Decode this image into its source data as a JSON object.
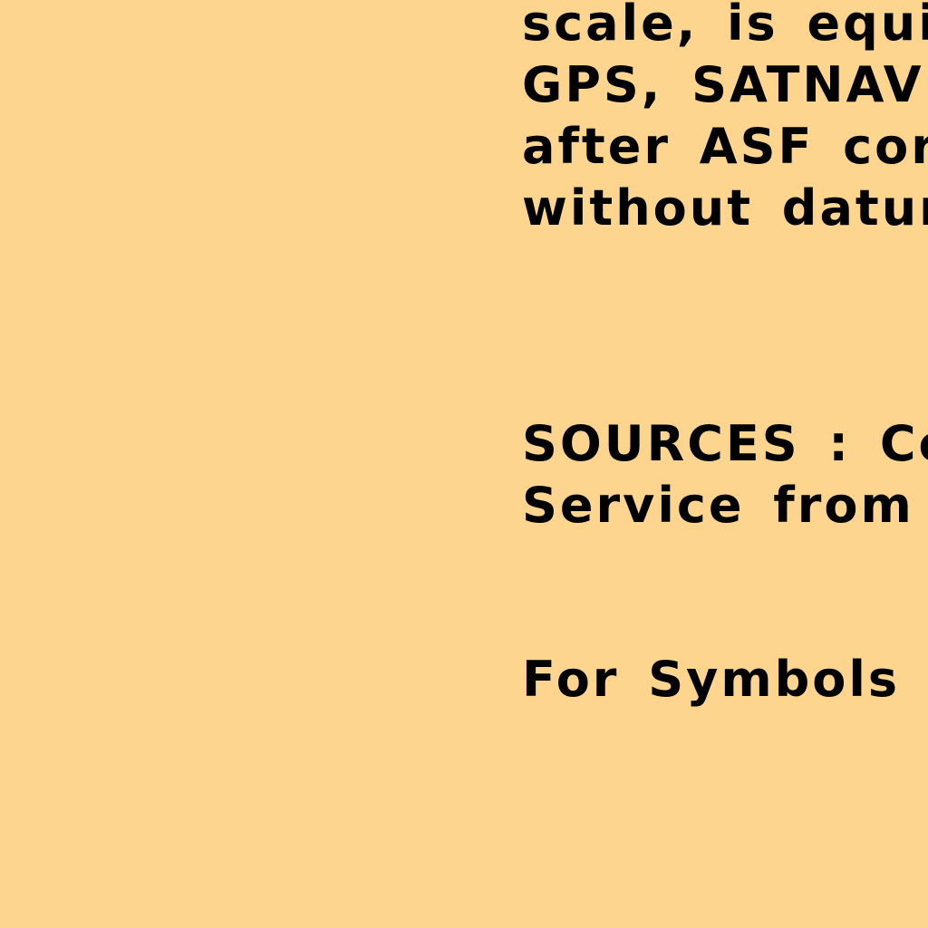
{
  "map": {
    "background_color": "#fdd58f",
    "text_color": "#000000",
    "notes_lines": [
      "scale, is equiva",
      "GPS, SATNAV",
      "after ASF corr",
      "without datum"
    ],
    "sources_lines": [
      "SOURCES : Cor",
      "Service from i"
    ],
    "symbols_lines": [
      "For Symbols a"
    ]
  }
}
